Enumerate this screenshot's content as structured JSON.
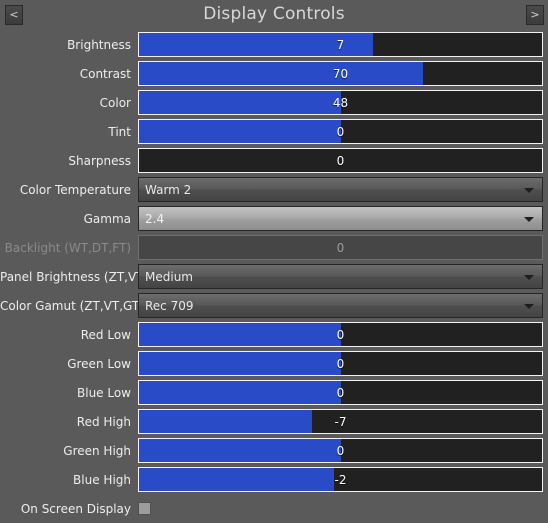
{
  "header": {
    "title": "Display Controls",
    "prev_label": "<",
    "next_label": ">"
  },
  "rows": [
    {
      "label": "Brightness",
      "type": "slider",
      "value": "7",
      "fill_pct": 58.0,
      "disabled": false
    },
    {
      "label": "Contrast",
      "type": "slider",
      "value": "70",
      "fill_pct": 70.5,
      "disabled": false
    },
    {
      "label": "Color",
      "type": "slider",
      "value": "48",
      "fill_pct": 50.0,
      "disabled": false
    },
    {
      "label": "Tint",
      "type": "slider",
      "value": "0",
      "fill_pct": 50.0,
      "disabled": false
    },
    {
      "label": "Sharpness",
      "type": "slider",
      "value": "0",
      "fill_pct": 0.0,
      "disabled": false
    },
    {
      "label": "Color Temperature",
      "type": "dropdown",
      "value": "Warm 2",
      "hover": false,
      "disabled": false
    },
    {
      "label": "Gamma",
      "type": "dropdown",
      "value": "2.4",
      "hover": true,
      "disabled": false
    },
    {
      "label": "Backlight (WT,DT,FT)",
      "type": "slider",
      "value": "0",
      "fill_pct": 0.0,
      "disabled": true
    },
    {
      "label": "Panel Brightness (ZT,VT,GT)",
      "type": "dropdown",
      "value": "Medium",
      "hover": false,
      "disabled": false
    },
    {
      "label": "Color Gamut (ZT,VT,GT)",
      "type": "dropdown",
      "value": "Rec 709",
      "hover": false,
      "disabled": false
    },
    {
      "label": "Red Low",
      "type": "slider",
      "value": "0",
      "fill_pct": 50.0,
      "disabled": false
    },
    {
      "label": "Green Low",
      "type": "slider",
      "value": "0",
      "fill_pct": 50.0,
      "disabled": false
    },
    {
      "label": "Blue Low",
      "type": "slider",
      "value": "0",
      "fill_pct": 50.0,
      "disabled": false
    },
    {
      "label": "Red High",
      "type": "slider",
      "value": "-7",
      "fill_pct": 43.0,
      "disabled": false
    },
    {
      "label": "Green High",
      "type": "slider",
      "value": "0",
      "fill_pct": 50.0,
      "disabled": false
    },
    {
      "label": "Blue High",
      "type": "slider",
      "value": "-2",
      "fill_pct": 48.3,
      "disabled": false
    },
    {
      "label": "On Screen Display",
      "type": "checkbox",
      "checked": false,
      "disabled": false
    }
  ],
  "colors": {
    "background": "#5a5a5a",
    "slider_fill": "#2a4bc8",
    "slider_track": "#212121",
    "slider_border": "#f2f2f2",
    "text": "#ededed",
    "disabled_text": "#8a8a8a"
  }
}
